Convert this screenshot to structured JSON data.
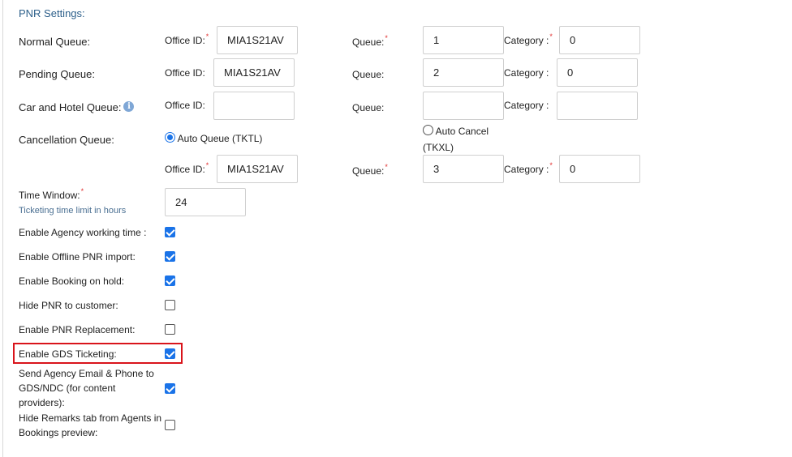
{
  "section_title": "PNR Settings:",
  "rows": {
    "normal": {
      "label": "Normal Queue:",
      "office_label": "Office ID:",
      "office_value": "MIA1S21AV",
      "queue_label": "Queue:",
      "queue_value": "1",
      "category_label": "Category :",
      "category_value": "0"
    },
    "pending": {
      "label": "Pending Queue:",
      "office_label": "Office ID:",
      "office_value": "MIA1S21AV",
      "queue_label": "Queue:",
      "queue_value": "2",
      "category_label": "Category :",
      "category_value": "0"
    },
    "carhotel": {
      "label": "Car and Hotel Queue:",
      "office_label": "Office ID:",
      "office_value": "",
      "queue_label": "Queue:",
      "queue_value": "",
      "category_label": "Category :",
      "category_value": ""
    },
    "cancellation": {
      "label": "Cancellation Queue:",
      "auto_queue_label": "Auto Queue (TKTL)",
      "auto_cancel_label_1": "Auto Cancel",
      "auto_cancel_label_2": "(TKXL)",
      "office_label": "Office ID:",
      "office_value": "MIA1S21AV",
      "queue_label": "Queue:",
      "queue_value": "3",
      "category_label": "Category :",
      "category_value": "0"
    }
  },
  "time_window": {
    "label": "Time Window:",
    "hint": "Ticketing time limit in hours",
    "value": "24"
  },
  "checkboxes": [
    {
      "label": "Enable Agency working time :",
      "checked": true
    },
    {
      "label": "Enable Offline PNR import:",
      "checked": true
    },
    {
      "label": "Enable Booking on hold:",
      "checked": true
    },
    {
      "label": "Hide PNR to customer:",
      "checked": false
    },
    {
      "label": "Enable PNR Replacement:",
      "checked": false
    },
    {
      "label": "Enable GDS Ticketing:",
      "checked": true
    },
    {
      "label": "Send Agency Email & Phone to GDS/NDC (for content providers):",
      "checked": true
    },
    {
      "label": "Hide Remarks tab from Agents in Bookings preview:",
      "checked": false
    }
  ],
  "colors": {
    "title": "#2c5f8a",
    "required": "#e03030",
    "checkbox_checked": "#1a73e8",
    "highlight": "#d9141b"
  },
  "icons": {
    "info": "info-circle-icon"
  }
}
